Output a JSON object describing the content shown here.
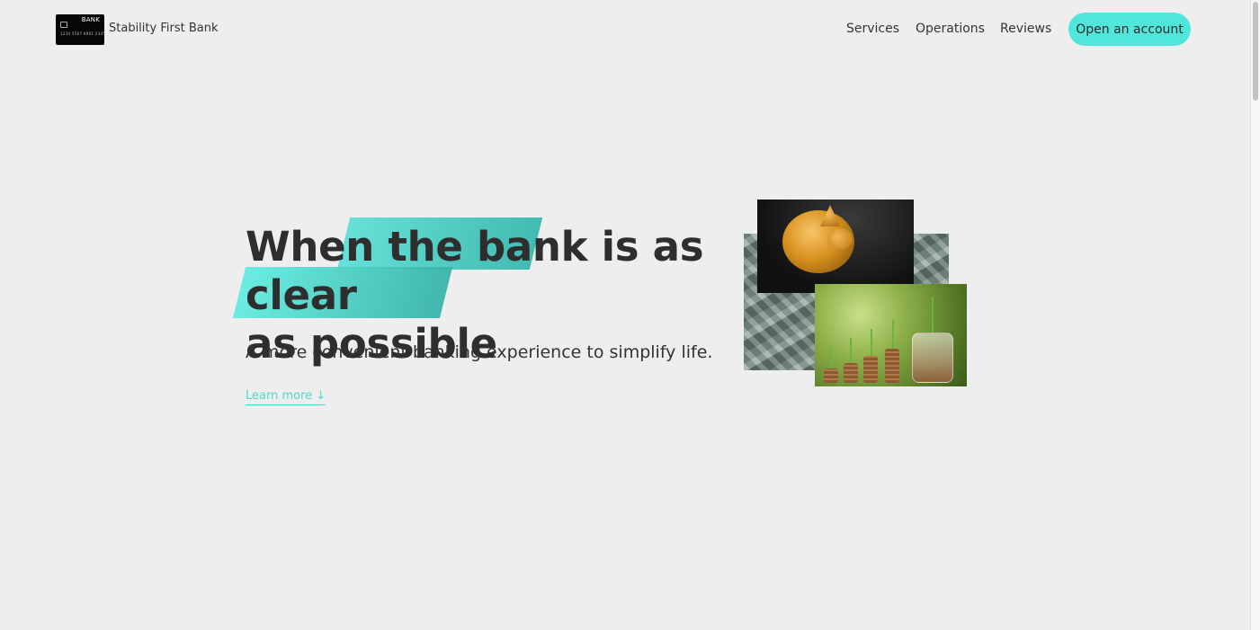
{
  "nav": {
    "logo": {
      "card_label": "BANK",
      "card_number": "1234 5567 8901 2345"
    },
    "brand_name": "Stability First Bank",
    "links": [
      {
        "label": "Services"
      },
      {
        "label": "Operations"
      },
      {
        "label": "Reviews"
      }
    ],
    "cta_label": "Open an account"
  },
  "hero": {
    "title_before": "When ",
    "title_highlight_1": "the bank ",
    "title_middle": "is as clear",
    "title_highlight_2": "as possible",
    "subtitle": "A more convenient banking experience to simplify life.",
    "learn_more": "Learn more ↓"
  },
  "images": {
    "piggy_bank": "golden-piggy-bank-photo",
    "money": "dollar-bills-photo",
    "coins": "coin-stacks-sprouts-photo"
  },
  "colors": {
    "accent": "#51e6dc",
    "highlight": "#4ccfc6",
    "text": "#2e2e2e",
    "background": "#eeeeee"
  }
}
